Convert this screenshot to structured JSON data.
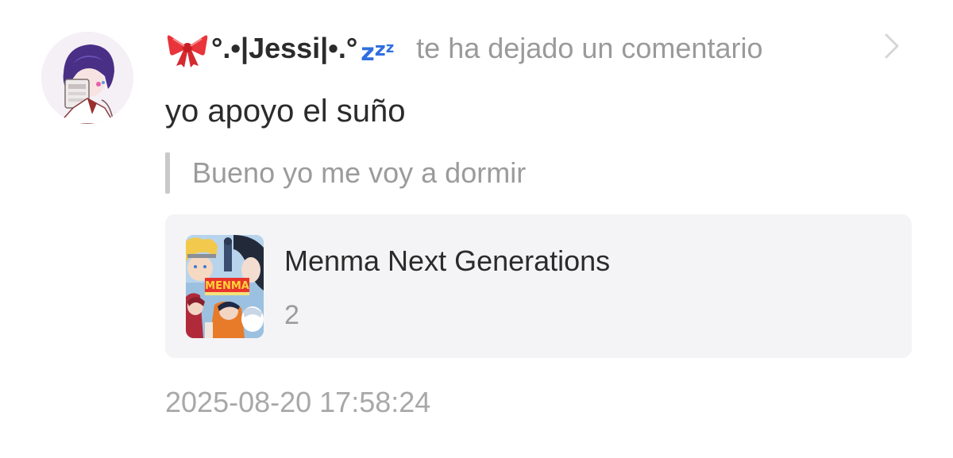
{
  "notification": {
    "username": "°.•|Jessi|•.°",
    "username_decoration_left": "ribbon-emoji",
    "username_decoration_right": "zzz-emoji",
    "zzz_glyphs": [
      "z",
      "z",
      "z"
    ],
    "action_text": "te ha dejado un comentario",
    "comment_text": "yo apoyo el suño",
    "quoted_text": "Bueno yo me voy a dormir",
    "timestamp": "2025-08-20 17:58:24"
  },
  "card": {
    "title": "Menma Next Generations",
    "count": "2",
    "thumbnail_logo_text": "MENMA"
  },
  "icons": {
    "chevron": "chevron-right-icon"
  },
  "colors": {
    "accent_zzz": "#2f6fe0",
    "ribbon": "#e8343a",
    "muted_text": "#9b9b9b",
    "card_background": "#f4f4f6"
  }
}
